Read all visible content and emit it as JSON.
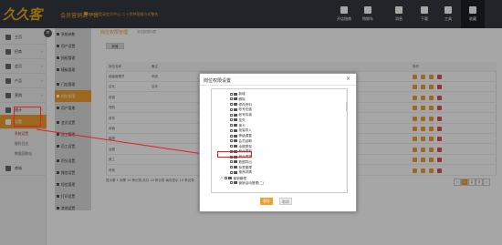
{
  "header": {
    "logo": "久久客",
    "brand": "会员营销云平台",
    "message": "欢迎登录会员中心,二十余种营销方式整合",
    "buttons": [
      {
        "label": "开店指南"
      },
      {
        "label": "购物车"
      },
      {
        "label": "消息"
      },
      {
        "label": "下载"
      },
      {
        "label": "工具"
      },
      {
        "label": "收藏"
      }
    ]
  },
  "sidebar": {
    "items": [
      {
        "label": "主页"
      },
      {
        "label": "招商"
      },
      {
        "label": "会员"
      },
      {
        "label": "产品"
      },
      {
        "label": "营销"
      },
      {
        "label": "统计"
      },
      {
        "label": "设置"
      },
      {
        "label": "商城"
      }
    ],
    "sub_items": [
      {
        "label": "系统设置"
      },
      {
        "label": "操作日志"
      },
      {
        "label": "数据回收站"
      }
    ]
  },
  "subcol": {
    "items": [
      {
        "label": "系统参数"
      },
      {
        "label": "用户设置"
      },
      {
        "label": "授权管理"
      },
      {
        "label": "模板管理"
      },
      {
        "label": "门店管理"
      },
      {
        "label": "岗位权限"
      },
      {
        "label": "用户管理"
      },
      {
        "label": "会员设置"
      },
      {
        "label": "员工管理"
      },
      {
        "label": "员工设置"
      },
      {
        "label": "积分设置"
      },
      {
        "label": "微信设置"
      },
      {
        "label": "短信管理"
      },
      {
        "label": "打印设置"
      },
      {
        "label": "其他设置"
      }
    ]
  },
  "main": {
    "breadcrumb": "岗位权限管理",
    "breadcrumb_hint": "岗位权限列表",
    "add_button": "新增",
    "columns": [
      "岗位名称",
      "备注",
      "操作"
    ],
    "rows": [
      {
        "name": "超级管理员",
        "note": "系统"
      },
      {
        "name": "店长",
        "note": "店长"
      },
      {
        "name": "收银",
        "note": ""
      },
      {
        "name": "导购",
        "note": ""
      },
      {
        "name": "财务",
        "note": ""
      },
      {
        "name": "库管",
        "note": ""
      },
      {
        "name": "客服",
        "note": ""
      },
      {
        "name": "运营",
        "note": ""
      },
      {
        "name": "美工",
        "note": ""
      },
      {
        "name": "其他",
        "note": ""
      }
    ],
    "pager_text": "显示第 1 到第 10 条记录,总共 10 条记录 每页显示 10 条记录",
    "pages": [
      "‹",
      "1",
      "2",
      "3",
      "›"
    ]
  },
  "dialog": {
    "title": "岗位权限设置",
    "close": "×",
    "tree": [
      {
        "label": "新增",
        "level": 2
      },
      {
        "label": "删除",
        "level": 2
      },
      {
        "label": "修改资料",
        "level": 2
      },
      {
        "label": "帐号充值",
        "level": 2
      },
      {
        "label": "帐号扣减",
        "level": 2
      },
      {
        "label": "挂失",
        "level": 2
      },
      {
        "label": "换卡",
        "level": 2
      },
      {
        "label": "批量导入",
        "level": 2
      },
      {
        "label": "等级调整",
        "level": 2
      },
      {
        "label": "会员延期",
        "level": 2
      },
      {
        "label": "余额提现",
        "level": 2
      },
      {
        "label": "积分提现",
        "level": 2
      },
      {
        "label": "积分清零",
        "level": 2
      },
      {
        "label": "数据导出",
        "level": 2
      },
      {
        "label": "标签管理",
        "level": 2
      },
      {
        "label": "推荐详情",
        "level": 2
      },
      {
        "label": "营销管理",
        "level": 1
      },
      {
        "label": "营销活动管理(二)",
        "level": 2
      }
    ],
    "ok_label": "保存",
    "cancel_label": "取消"
  }
}
